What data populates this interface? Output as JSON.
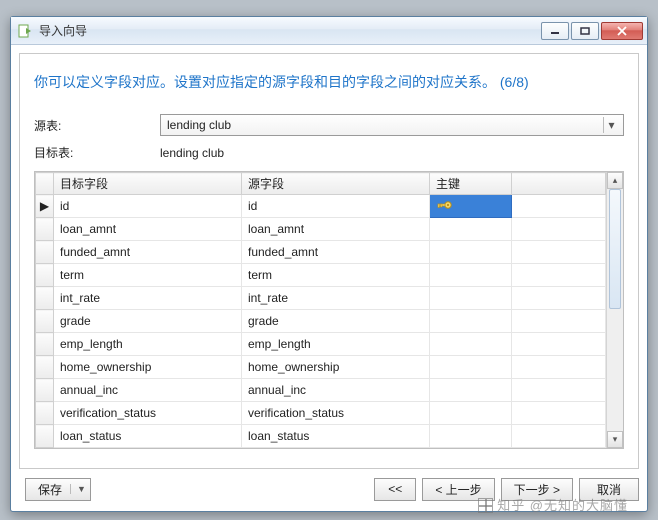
{
  "window": {
    "title": "导入向导"
  },
  "heading": "你可以定义字段对应。设置对应指定的源字段和目的字段之间的对应关系。 (6/8)",
  "source": {
    "label": "源表:",
    "value": "lending club"
  },
  "target": {
    "label": "目标表:",
    "value": "lending club"
  },
  "columns": {
    "target_field": "目标字段",
    "source_field": "源字段",
    "primary_key": "主键"
  },
  "rows": [
    {
      "target": "id",
      "source": "id",
      "selected": true
    },
    {
      "target": "loan_amnt",
      "source": "loan_amnt"
    },
    {
      "target": "funded_amnt",
      "source": "funded_amnt"
    },
    {
      "target": "term",
      "source": "term"
    },
    {
      "target": "int_rate",
      "source": "int_rate"
    },
    {
      "target": "grade",
      "source": "grade"
    },
    {
      "target": "emp_length",
      "source": "emp_length"
    },
    {
      "target": "home_ownership",
      "source": "home_ownership"
    },
    {
      "target": "annual_inc",
      "source": "annual_inc"
    },
    {
      "target": "verification_status",
      "source": "verification_status"
    },
    {
      "target": "loan_status",
      "source": "loan_status"
    }
  ],
  "buttons": {
    "save": "保存",
    "first": "<<",
    "prev": "< 上一步",
    "next": "下一步 >",
    "cancel": "取消"
  },
  "watermark": "知乎 @无知的大脑懂"
}
